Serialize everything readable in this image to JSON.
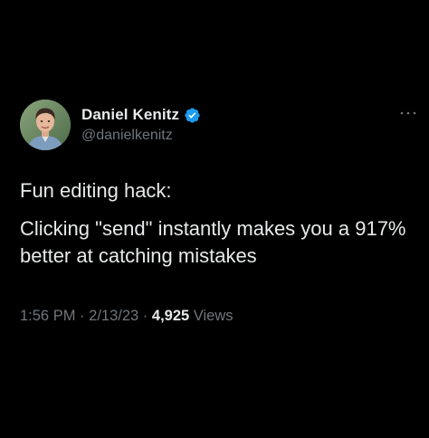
{
  "author": {
    "display_name": "Daniel Kenitz",
    "handle": "@danielkenitz",
    "verified": true,
    "verified_color": "#1d9bf0",
    "avatar_icon": "profile-photo"
  },
  "menu_icon": "more-horizontal-icon",
  "tweet": {
    "line1": "Fun editing hack:",
    "line2": "Clicking \"send\" instantly makes you a 917% better at catching mistakes"
  },
  "meta": {
    "time": "1:56 PM",
    "separator": "·",
    "date": "2/13/23",
    "views_count": "4,925",
    "views_label": "Views"
  },
  "colors": {
    "background": "#000000",
    "primary_text": "#e7e9ea",
    "secondary_text": "#71767b"
  }
}
